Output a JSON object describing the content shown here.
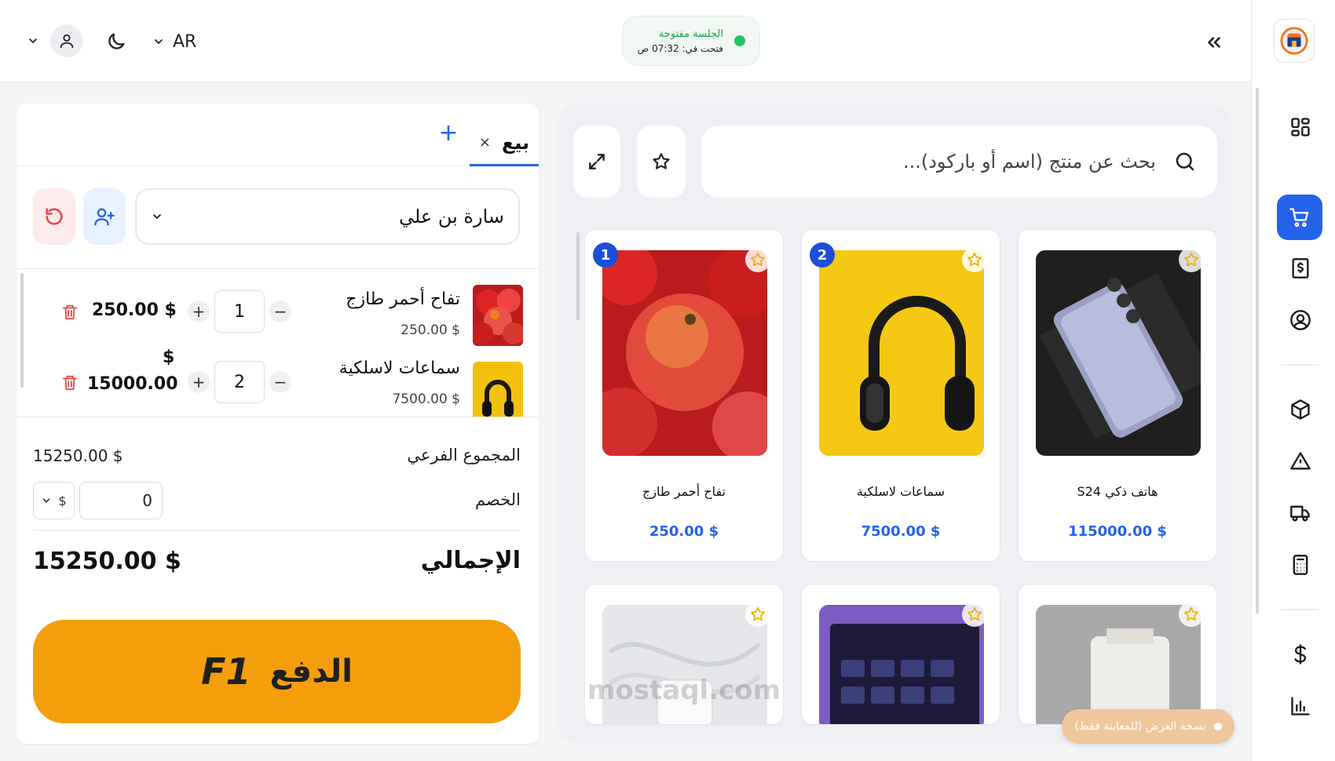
{
  "header": {
    "session": {
      "title": "الجلسة مفتوحة",
      "opened_at": "فتحت في: 07:32 ص"
    },
    "language": "AR"
  },
  "sidebar": {
    "items": [
      {
        "name": "dashboard",
        "icon": "grid-icon"
      },
      {
        "name": "pos-cart",
        "icon": "cart-icon",
        "active": true
      },
      {
        "name": "invoices",
        "icon": "receipt-icon"
      },
      {
        "name": "customers",
        "icon": "user-circle-icon"
      },
      {
        "name": "products",
        "icon": "box-icon"
      },
      {
        "name": "alerts",
        "icon": "warning-icon"
      },
      {
        "name": "shipping",
        "icon": "truck-icon"
      },
      {
        "name": "calculator",
        "icon": "calculator-icon"
      },
      {
        "name": "finance",
        "icon": "dollar-icon"
      },
      {
        "name": "reports",
        "icon": "chart-icon"
      }
    ],
    "accent": "#2563eb"
  },
  "cart": {
    "tab_label": "بيع",
    "tab_close": "×",
    "tab_add": "+",
    "customer": "سارة بن علي",
    "items": [
      {
        "name": "تفاح أحمر طازج",
        "unit_price": "250.00 $",
        "qty": "1",
        "line_total": "250.00 $",
        "thumb": "apple"
      },
      {
        "name": "سماعات لاسلكية",
        "unit_price": "7500.00 $",
        "qty": "2",
        "line_total_currency": "$",
        "line_total_amount": "15000.00",
        "thumb": "headphones"
      }
    ],
    "summary": {
      "subtotal_label": "المجموع الفرعي",
      "subtotal_value": "15250.00 $",
      "discount_label": "الخصم",
      "discount_value": "0",
      "discount_currency": "$",
      "total_label": "الإجمالي",
      "total_value": "15250.00 $"
    },
    "pay": {
      "label": "الدفع",
      "shortcut": "F1",
      "color": "#f59e0b"
    }
  },
  "products": {
    "search_placeholder": "بحث عن منتج (اسم أو باركود)...",
    "cards": [
      {
        "name": "هاتف ذكي S24",
        "price": "115000.00 $",
        "image": "phone"
      },
      {
        "name": "سماعات لاسلكية",
        "price": "7500.00 $",
        "image": "headphones",
        "badge": "2"
      },
      {
        "name": "تفاح أحمر طازج",
        "price": "250.00 $",
        "image": "apple",
        "badge": "1"
      },
      {
        "image": "coffee-bag"
      },
      {
        "image": "tv"
      },
      {
        "image": "charger"
      }
    ],
    "price_color": "#2563eb"
  },
  "demo_badge": "نسخة العرض (للمعاينة فقط)",
  "watermark": "mostaql.com"
}
